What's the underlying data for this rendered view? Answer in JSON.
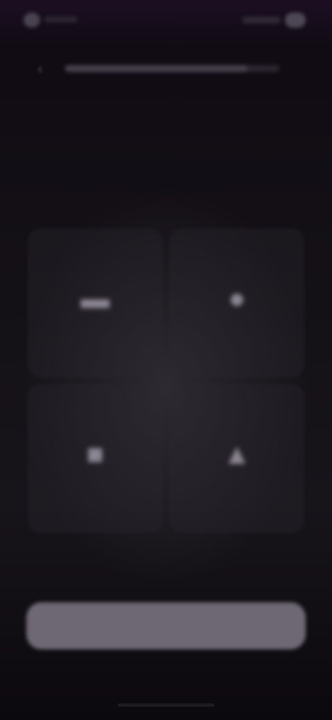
{
  "status_bar": {
    "time": "",
    "indicators": ""
  },
  "header": {
    "back_icon": "chevron-left-icon",
    "back_glyph": "‹",
    "progress_fraction": 0.85
  },
  "question": {
    "title": "",
    "subtitle": ""
  },
  "options": [
    {
      "icon": "option-icon-1",
      "glyph": "▬",
      "label": ""
    },
    {
      "icon": "option-icon-2",
      "glyph": "●",
      "label": ""
    },
    {
      "icon": "option-icon-3",
      "glyph": "■",
      "label": ""
    },
    {
      "icon": "option-icon-4",
      "glyph": "▲",
      "label": ""
    }
  ],
  "footer": {
    "skip_label": "",
    "continue_label": ""
  },
  "colors": {
    "background": "#141116",
    "button": "#6e6874",
    "card": "#2c2930"
  }
}
